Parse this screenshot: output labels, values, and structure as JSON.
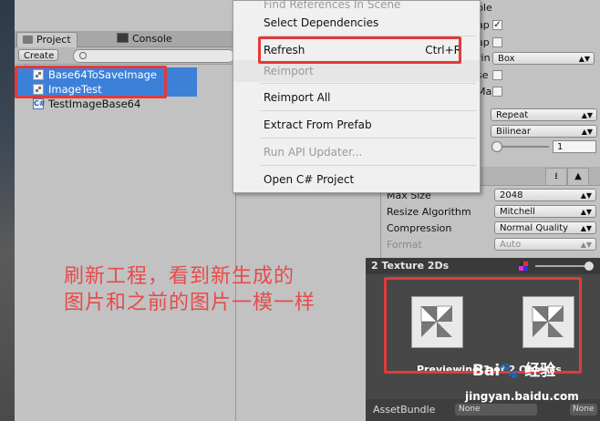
{
  "project_panel": {
    "tabs": [
      {
        "label": "Project",
        "icon": "folder-icon"
      },
      {
        "label": "Console",
        "icon": "console-icon"
      }
    ],
    "create_label": "Create ▾",
    "search_placeholder": "",
    "files": [
      {
        "name": "Base64ToSaveImage",
        "icon": "texture-icon",
        "selected": true
      },
      {
        "name": "ImageTest",
        "icon": "texture-icon",
        "selected": true
      },
      {
        "name": "TestImageBase64",
        "icon": "csharp-script-icon",
        "selected": false
      }
    ]
  },
  "context_menu": {
    "items": [
      {
        "label": "Find References In Scene",
        "enabled": false
      },
      {
        "label": "Select Dependencies",
        "enabled": true
      },
      {
        "label": "Refresh",
        "shortcut": "Ctrl+R",
        "enabled": true
      },
      {
        "label": "Reimport",
        "enabled": false
      },
      {
        "label": "Reimport All",
        "enabled": true
      },
      {
        "label": "Extract From Prefab",
        "enabled": true
      },
      {
        "label": "Run API Updater...",
        "enabled": false
      },
      {
        "label": "Open C# Project",
        "enabled": true
      }
    ]
  },
  "inspector": {
    "partial_labels": [
      "ble",
      "ap",
      "ap",
      "rin",
      "se",
      "Ma"
    ],
    "mesh_type": "Box",
    "wrap_mode": "Repeat",
    "filter_mode": "Bilinear",
    "aniso_level": "1",
    "max_size_label": "Max Size",
    "max_size": "2048",
    "resize_label": "Resize Algorithm",
    "resize": "Mitchell",
    "compression_label": "Compression",
    "compression": "Normal Quality",
    "format_label": "Format",
    "format": "Auto"
  },
  "preview": {
    "title": "2 Texture 2Ds",
    "caption": "Previewing 2 of 2 Objects",
    "asset_bundle_label": "AssetBundle",
    "asset_bundle_value": "None",
    "asset_bundle_variant": "None"
  },
  "annotation": {
    "line1": "刷新工程，看到新生成的",
    "line2": "图片和之前的图片一模一样"
  },
  "watermark": {
    "brand": "Bai🐾 经验",
    "url": "jingyan.baidu.com"
  },
  "colors": {
    "highlight": "#e23a3a",
    "selection": "#3d80d8"
  }
}
